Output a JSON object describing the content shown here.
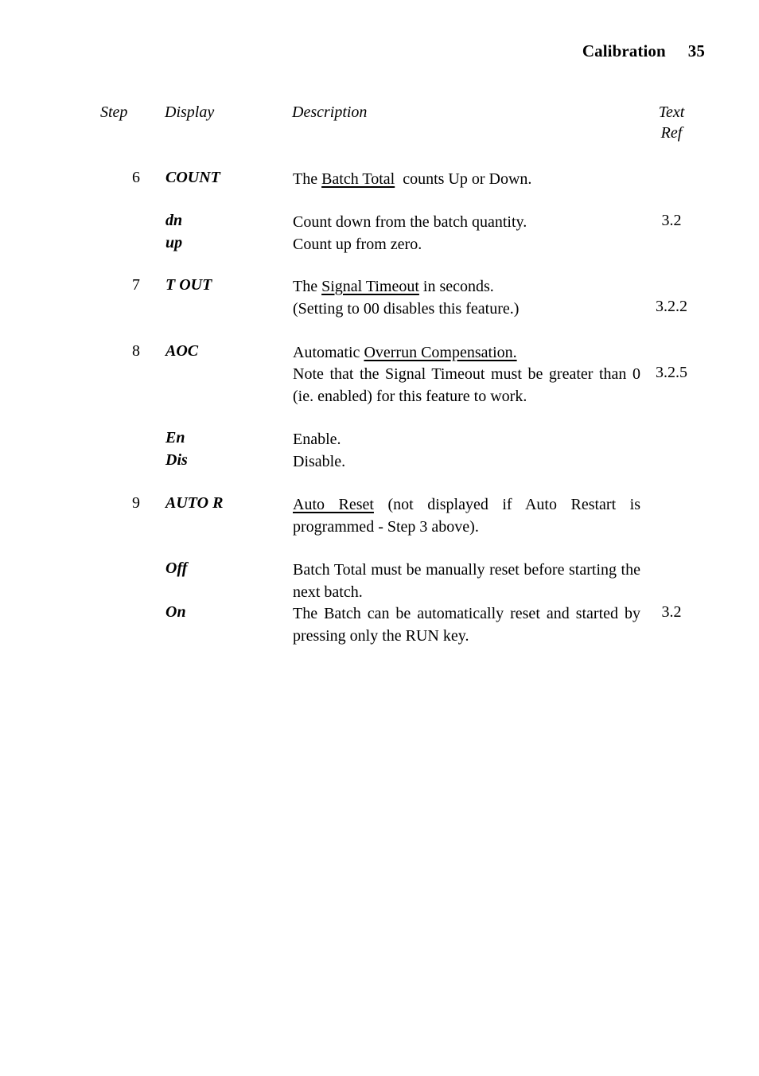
{
  "header": {
    "chapter": "Calibration",
    "page_number": "35"
  },
  "table": {
    "columns": {
      "step": "Step",
      "display": "Display",
      "description": "Description",
      "text_ref_line1": "Text",
      "text_ref_line2": "Ref"
    },
    "rows": [
      {
        "step": "6",
        "display": "COUNT",
        "desc_pre": "The ",
        "desc_underlined": "Batch Total",
        "desc_post": "  counts Up or Down.",
        "ref": ""
      },
      {
        "step": "",
        "display": "dn",
        "desc_pre": "Count down from the batch quantity.",
        "desc_underlined": "",
        "desc_post": "",
        "ref": "3.2"
      },
      {
        "step": "",
        "display": "up",
        "desc_pre": "Count up from zero.",
        "desc_underlined": "",
        "desc_post": "",
        "ref": ""
      },
      {
        "step": "7",
        "display": "T OUT",
        "desc_pre": "The ",
        "desc_underlined": "Signal Timeout",
        "desc_post": " in seconds.",
        "desc_line2": "(Setting to 00 disables this feature.)",
        "ref": "3.2.2"
      },
      {
        "step": "8",
        "display": "AOC",
        "desc_pre": "Automatic ",
        "desc_underlined": "Overrun Compensation.",
        "desc_post": "",
        "desc_body": "Note that the Signal Timeout must be greater than 0 (ie. enabled) for this feature to work.",
        "ref": "3.2.5"
      },
      {
        "step": "",
        "display": "En",
        "desc_pre": "Enable.",
        "desc_underlined": "",
        "desc_post": "",
        "ref": ""
      },
      {
        "step": "",
        "display": "Dis",
        "desc_pre": "Disable.",
        "desc_underlined": "",
        "desc_post": "",
        "ref": ""
      },
      {
        "step": "9",
        "display": "AUTO R",
        "desc_pre": "",
        "desc_underlined": "Auto Reset",
        "desc_post": " (not displayed if Auto Restart is programmed - Step 3 above).",
        "ref": ""
      },
      {
        "step": "",
        "display": "Off",
        "desc_pre": "Batch Total must be manually reset before starting the next batch.",
        "desc_underlined": "",
        "desc_post": "",
        "ref": ""
      },
      {
        "step": "",
        "display": "On",
        "desc_pre": "The Batch can be automatically reset and started by pressing only the RUN key.",
        "desc_underlined": "",
        "desc_post": "",
        "ref": "3.2"
      }
    ]
  }
}
